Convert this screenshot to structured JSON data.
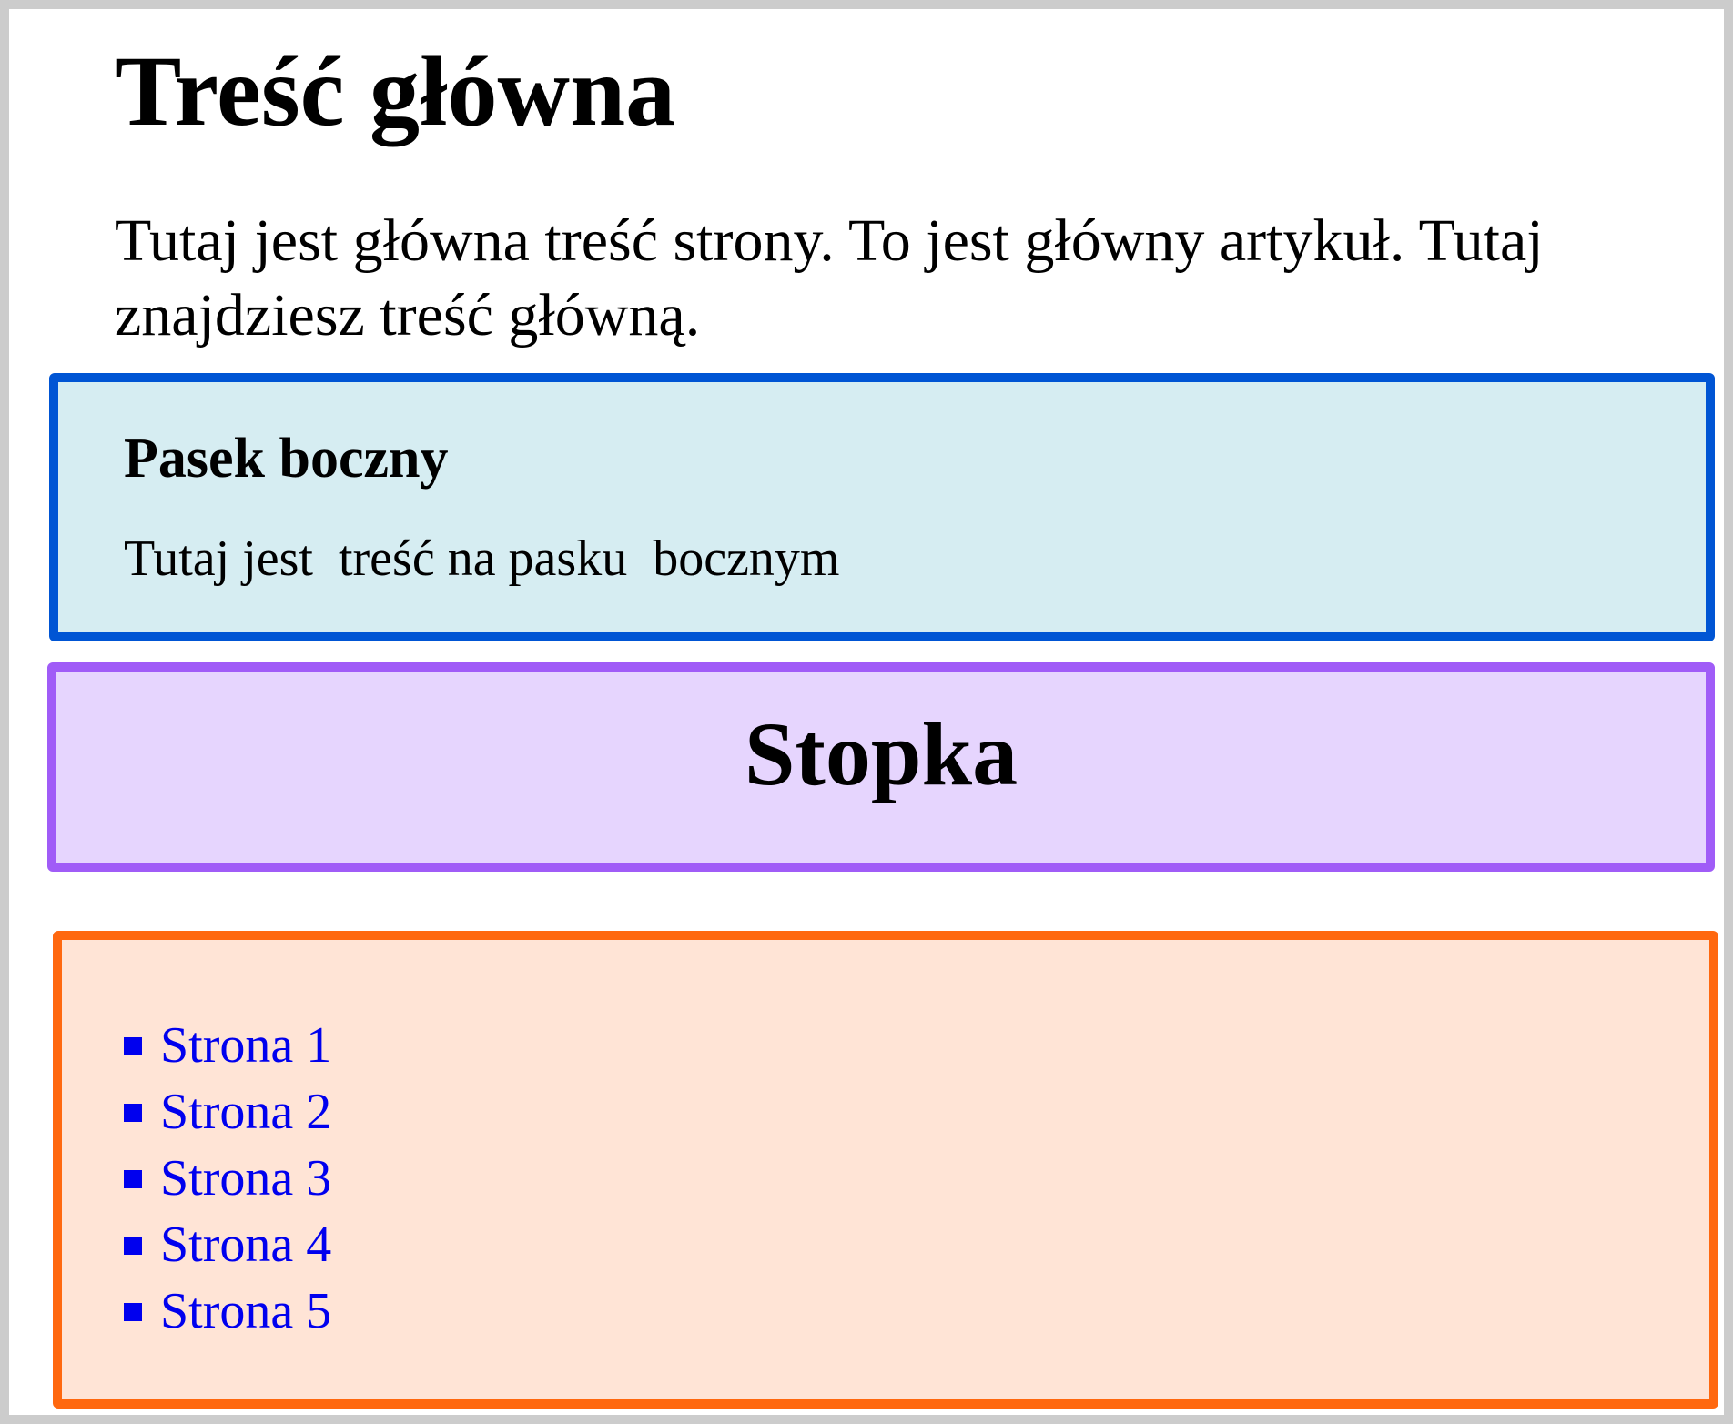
{
  "main": {
    "title": "Treść główna",
    "text": "Tutaj jest główna treść strony. To jest główny artykuł. Tutaj znajdziesz treść główną."
  },
  "sidebar": {
    "title": "Pasek boczny",
    "text": "Tutaj jest  treść na pasku  bocznym"
  },
  "footer": {
    "title": "Stopka"
  },
  "nav": {
    "items": [
      {
        "label": "Strona 1"
      },
      {
        "label": "Strona 2"
      },
      {
        "label": "Strona 3"
      },
      {
        "label": "Strona 4"
      },
      {
        "label": "Strona 5"
      }
    ]
  },
  "colors": {
    "frame_border": "#cccccc",
    "sidebar_border": "#0055d4",
    "sidebar_bg": "#d6edf2",
    "footer_border": "#a05cf7",
    "footer_bg": "#e6d5fe",
    "nav_border": "#ff680f",
    "nav_bg": "#ffe4d6",
    "link": "#0000ee"
  }
}
